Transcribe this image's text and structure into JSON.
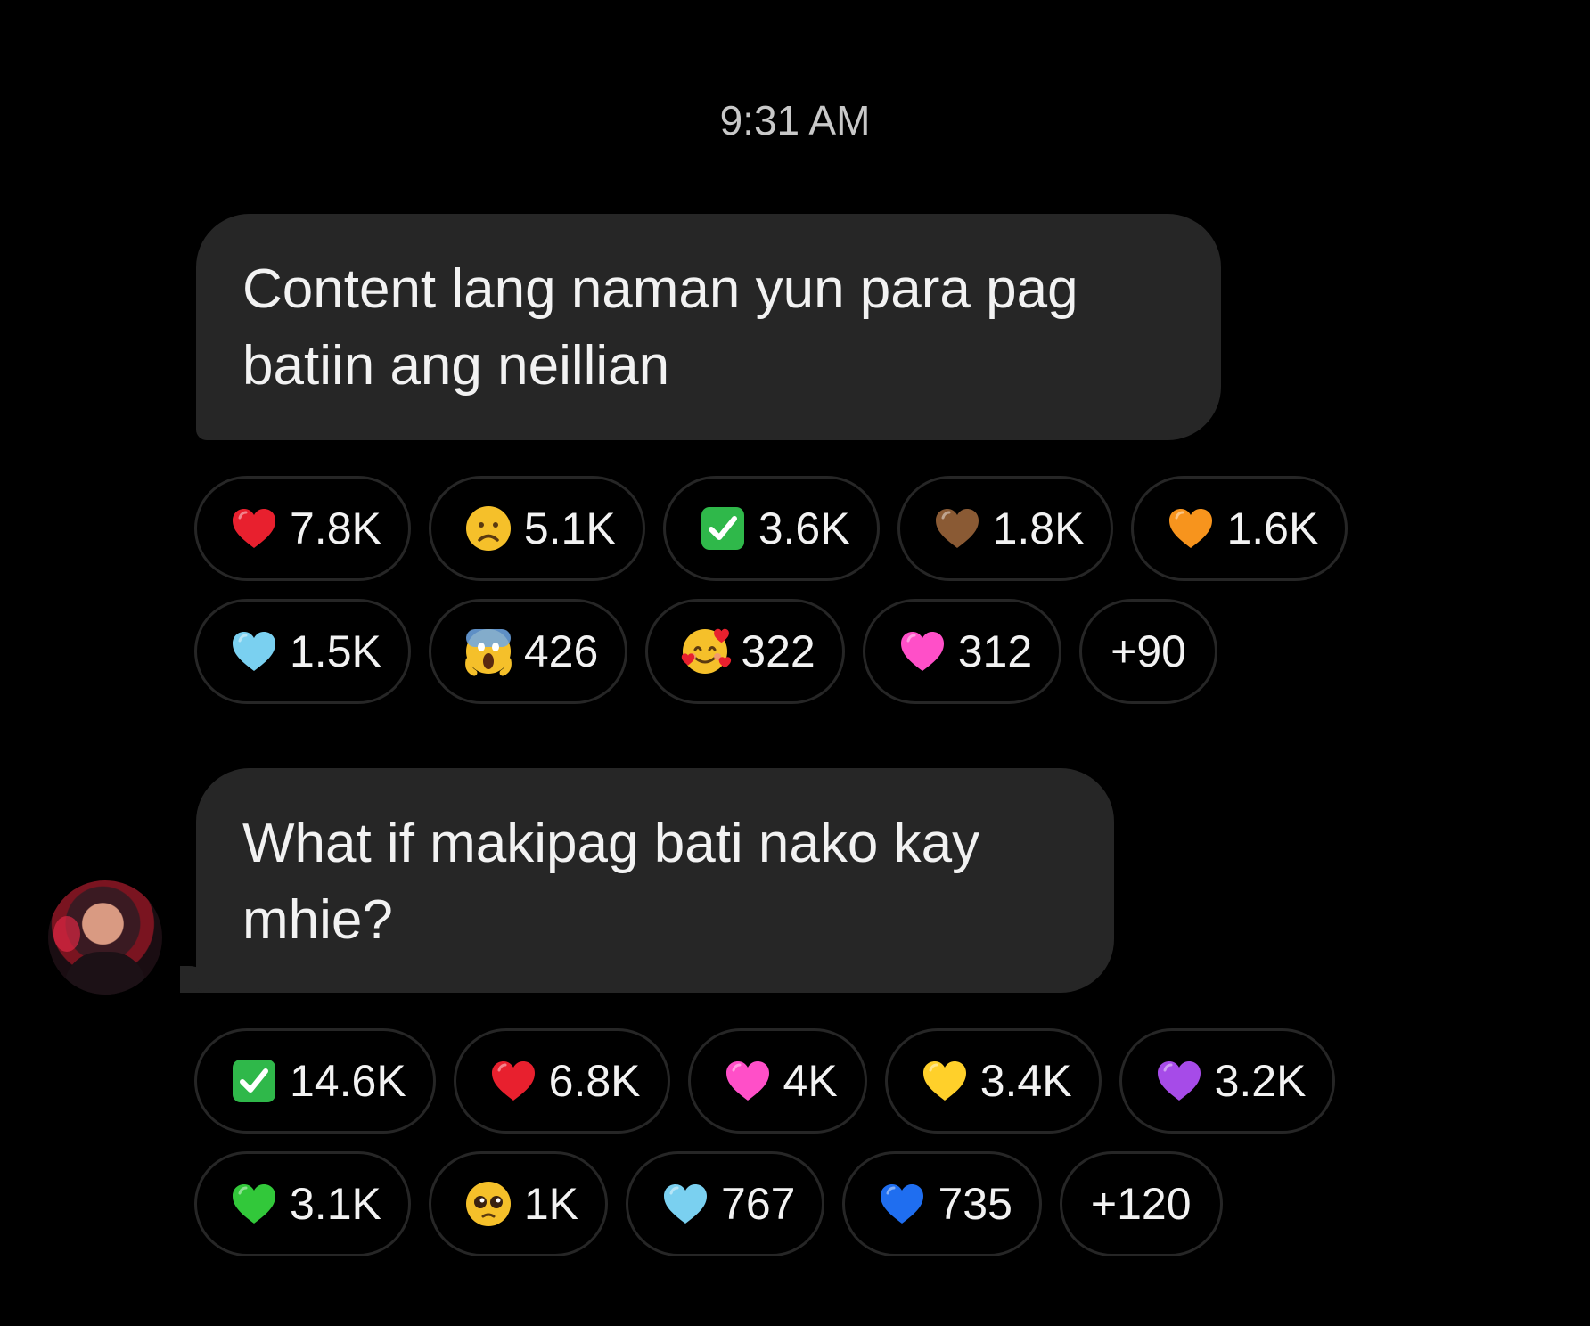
{
  "timestamp": "9:31 AM",
  "colors": {
    "background": "#000000",
    "bubble": "#262626",
    "text": "#f2f2f2",
    "timestamp": "#c8c8c8"
  },
  "messages": [
    {
      "lines": [
        "Content lang naman yun para pag",
        "batiin ang neillian"
      ],
      "reactions": [
        {
          "icon": "red-heart-icon",
          "color": "#e8202e",
          "count": "7.8K"
        },
        {
          "icon": "frowning-face-icon",
          "color": "#f5c02a",
          "count": "5.1K"
        },
        {
          "icon": "check-mark-button-icon",
          "color": "#2fb84a",
          "count": "3.6K"
        },
        {
          "icon": "brown-heart-icon",
          "color": "#8a5a34",
          "count": "1.8K"
        },
        {
          "icon": "orange-heart-icon",
          "color": "#f7941d",
          "count": "1.6K"
        },
        {
          "icon": "light-blue-heart-icon",
          "color": "#7ad0f0",
          "count": "1.5K"
        },
        {
          "icon": "screaming-face-icon",
          "color": "#f5c02a",
          "count": "426"
        },
        {
          "icon": "smiling-face-with-hearts-icon",
          "color": "#f5c02a",
          "count": "322"
        },
        {
          "icon": "pink-heart-icon",
          "color": "#ff4fc8",
          "count": "312"
        }
      ],
      "more": "+90"
    },
    {
      "lines": [
        "What if makipag bati nako kay",
        "mhie?"
      ],
      "reactions": [
        {
          "icon": "check-mark-button-icon",
          "color": "#2fb84a",
          "count": "14.6K"
        },
        {
          "icon": "red-heart-icon",
          "color": "#e8202e",
          "count": "6.8K"
        },
        {
          "icon": "pink-heart-icon",
          "color": "#ff4fc8",
          "count": "4K"
        },
        {
          "icon": "yellow-heart-icon",
          "color": "#ffd02a",
          "count": "3.4K"
        },
        {
          "icon": "purple-heart-icon",
          "color": "#a64be8",
          "count": "3.2K"
        },
        {
          "icon": "green-heart-icon",
          "color": "#32c83a",
          "count": "3.1K"
        },
        {
          "icon": "pleading-face-icon",
          "color": "#f5c02a",
          "count": "1K"
        },
        {
          "icon": "light-blue-heart-icon",
          "color": "#7ad0f0",
          "count": "767"
        },
        {
          "icon": "blue-heart-icon",
          "color": "#1f6ef0",
          "count": "735"
        }
      ],
      "more": "+120"
    }
  ]
}
